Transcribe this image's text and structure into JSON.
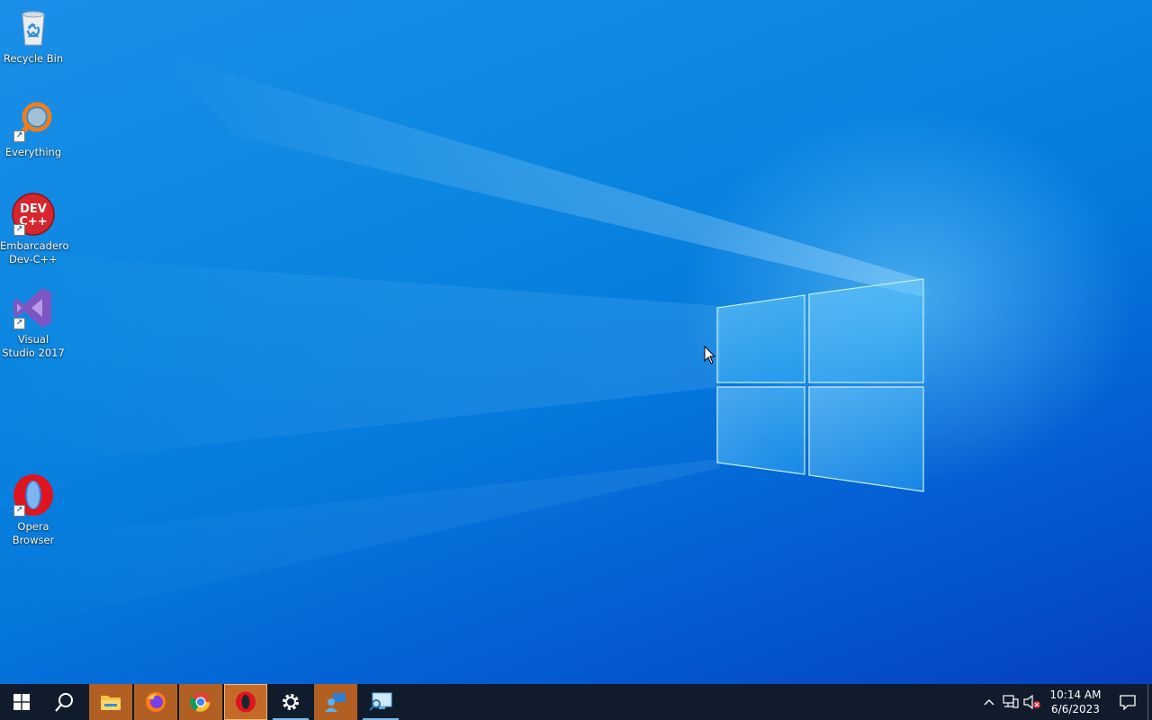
{
  "desktop": {
    "icons": [
      {
        "label": "Recycle Bin",
        "icon": "recycle-bin-icon",
        "shortcut": false
      },
      {
        "label": "Everything",
        "icon": "everything-search-icon",
        "shortcut": true
      },
      {
        "label": "Embarcadero Dev-C++",
        "icon": "dev-cpp-icon",
        "icon_text": "DEV C++",
        "shortcut": true
      },
      {
        "label": "Visual Studio 2017",
        "icon": "visual-studio-icon",
        "shortcut": true
      },
      {
        "label": "Opera Browser",
        "icon": "opera-icon",
        "shortcut": true
      }
    ]
  },
  "taskbar": {
    "items": [
      {
        "name": "start-button",
        "icon": "windows-start-icon"
      },
      {
        "name": "search-button",
        "icon": "search-icon"
      },
      {
        "name": "file-explorer",
        "icon": "folder-icon",
        "state": "pinned"
      },
      {
        "name": "firefox",
        "icon": "firefox-icon",
        "state": "pinned"
      },
      {
        "name": "chrome",
        "icon": "chrome-icon",
        "state": "pinned"
      },
      {
        "name": "opera",
        "icon": "opera-icon",
        "state": "active"
      },
      {
        "name": "settings",
        "icon": "gear-icon",
        "state": "running"
      },
      {
        "name": "remote-users",
        "icon": "users-icon",
        "state": "pinned"
      },
      {
        "name": "remote-desktop",
        "icon": "monitor-search-icon",
        "state": "running"
      }
    ],
    "tray": {
      "time": "10:14 AM",
      "date": "6/6/2023",
      "icons": [
        "chevron-up-icon",
        "network-icon",
        "volume-muted-icon",
        "notification-icon"
      ]
    }
  },
  "colors": {
    "taskbar_bg": "#101c2b",
    "pinned_bg": "#b25f23",
    "accent_underline": "#76b9ed",
    "desktop_blue": "#0579dc"
  }
}
